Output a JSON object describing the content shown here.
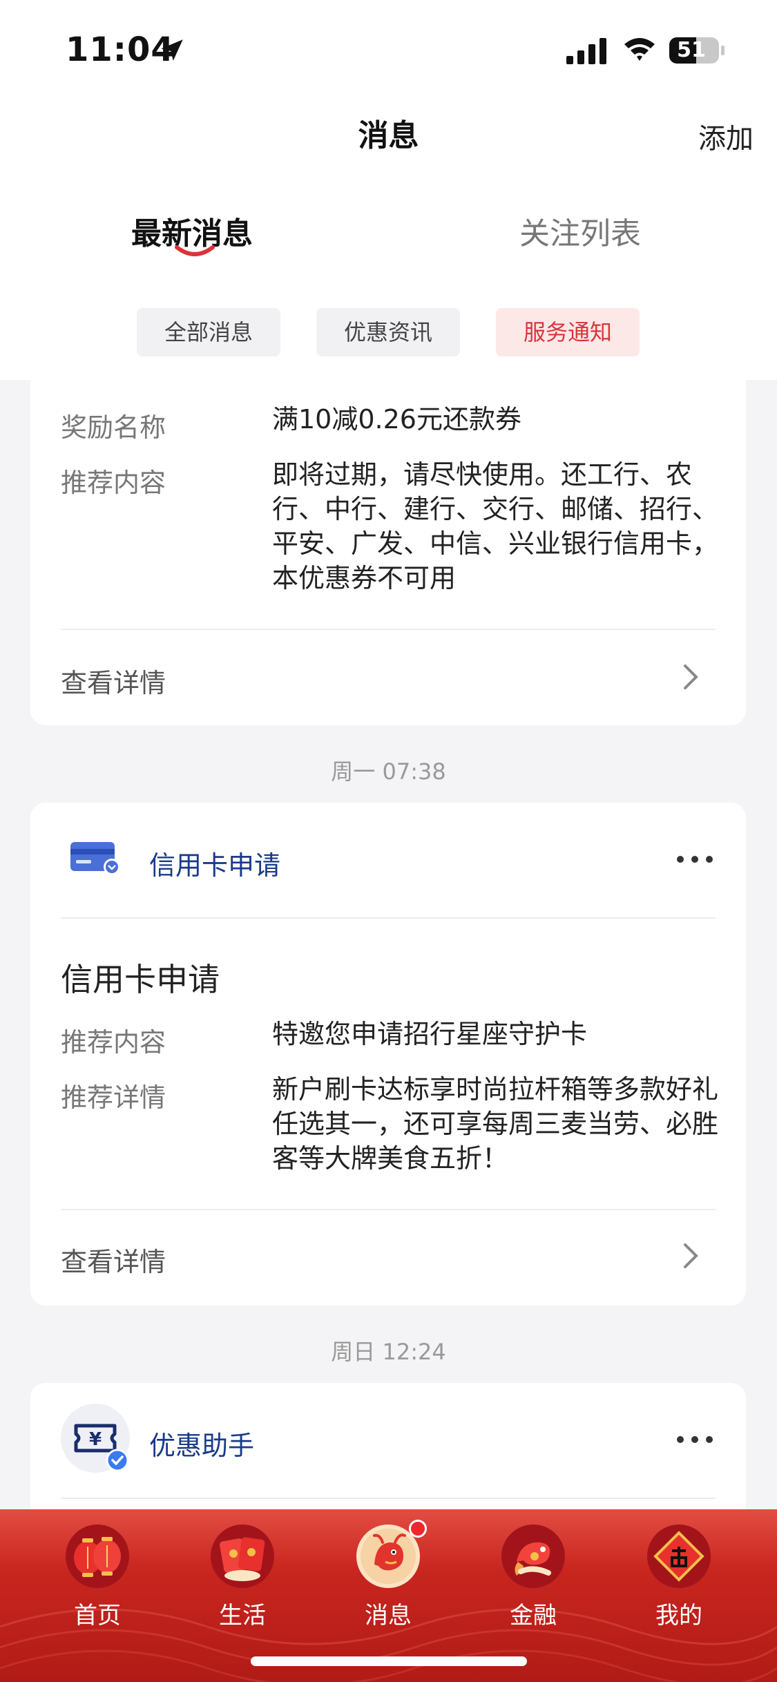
{
  "status_bar": {
    "time": "11:04",
    "battery": "51"
  },
  "nav": {
    "title": "消息",
    "add_label": "添加"
  },
  "tabs": [
    {
      "label": "最新消息",
      "active": true
    },
    {
      "label": "关注列表",
      "active": false
    }
  ],
  "filters": [
    {
      "label": "全部消息"
    },
    {
      "label": "优惠资讯"
    },
    {
      "label": "服务通知",
      "active": true
    }
  ],
  "card1": {
    "rows": [
      {
        "label": "奖励名称",
        "value": "满10减0.26元还款券"
      },
      {
        "label": "推荐内容",
        "value": "即将过期，请尽快使用。还工行、农行、中行、建行、交行、邮储、招行、平安、广发、中信、兴业银行信用卡，本优惠券不可用"
      }
    ],
    "detail_label": "查看详情"
  },
  "date1": "周一 07:38",
  "card2": {
    "source": "信用卡申请",
    "title": "信用卡申请",
    "rows": [
      {
        "label": "推荐内容",
        "value": "特邀您申请招行星座守护卡"
      },
      {
        "label": "推荐详情",
        "value": "新户刷卡达标享时尚拉杆箱等多款好礼任选其一，还可享每周三麦当劳、必胜客等大牌美食五折！"
      }
    ],
    "detail_label": "查看详情"
  },
  "date2": "周日 12:24",
  "card3": {
    "source": "优惠助手"
  },
  "tabbar": [
    {
      "label": "首页",
      "icon": "lantern-icon"
    },
    {
      "label": "生活",
      "icon": "red-envelope-icon"
    },
    {
      "label": "消息",
      "icon": "dragon-icon",
      "badge": true
    },
    {
      "label": "金融",
      "icon": "koi-icon"
    },
    {
      "label": "我的",
      "icon": "fu-icon"
    }
  ],
  "colors": {
    "accent_red": "#d9343a",
    "source_blue": "#1a3a8a",
    "tabbar_red": "#c8261f"
  }
}
